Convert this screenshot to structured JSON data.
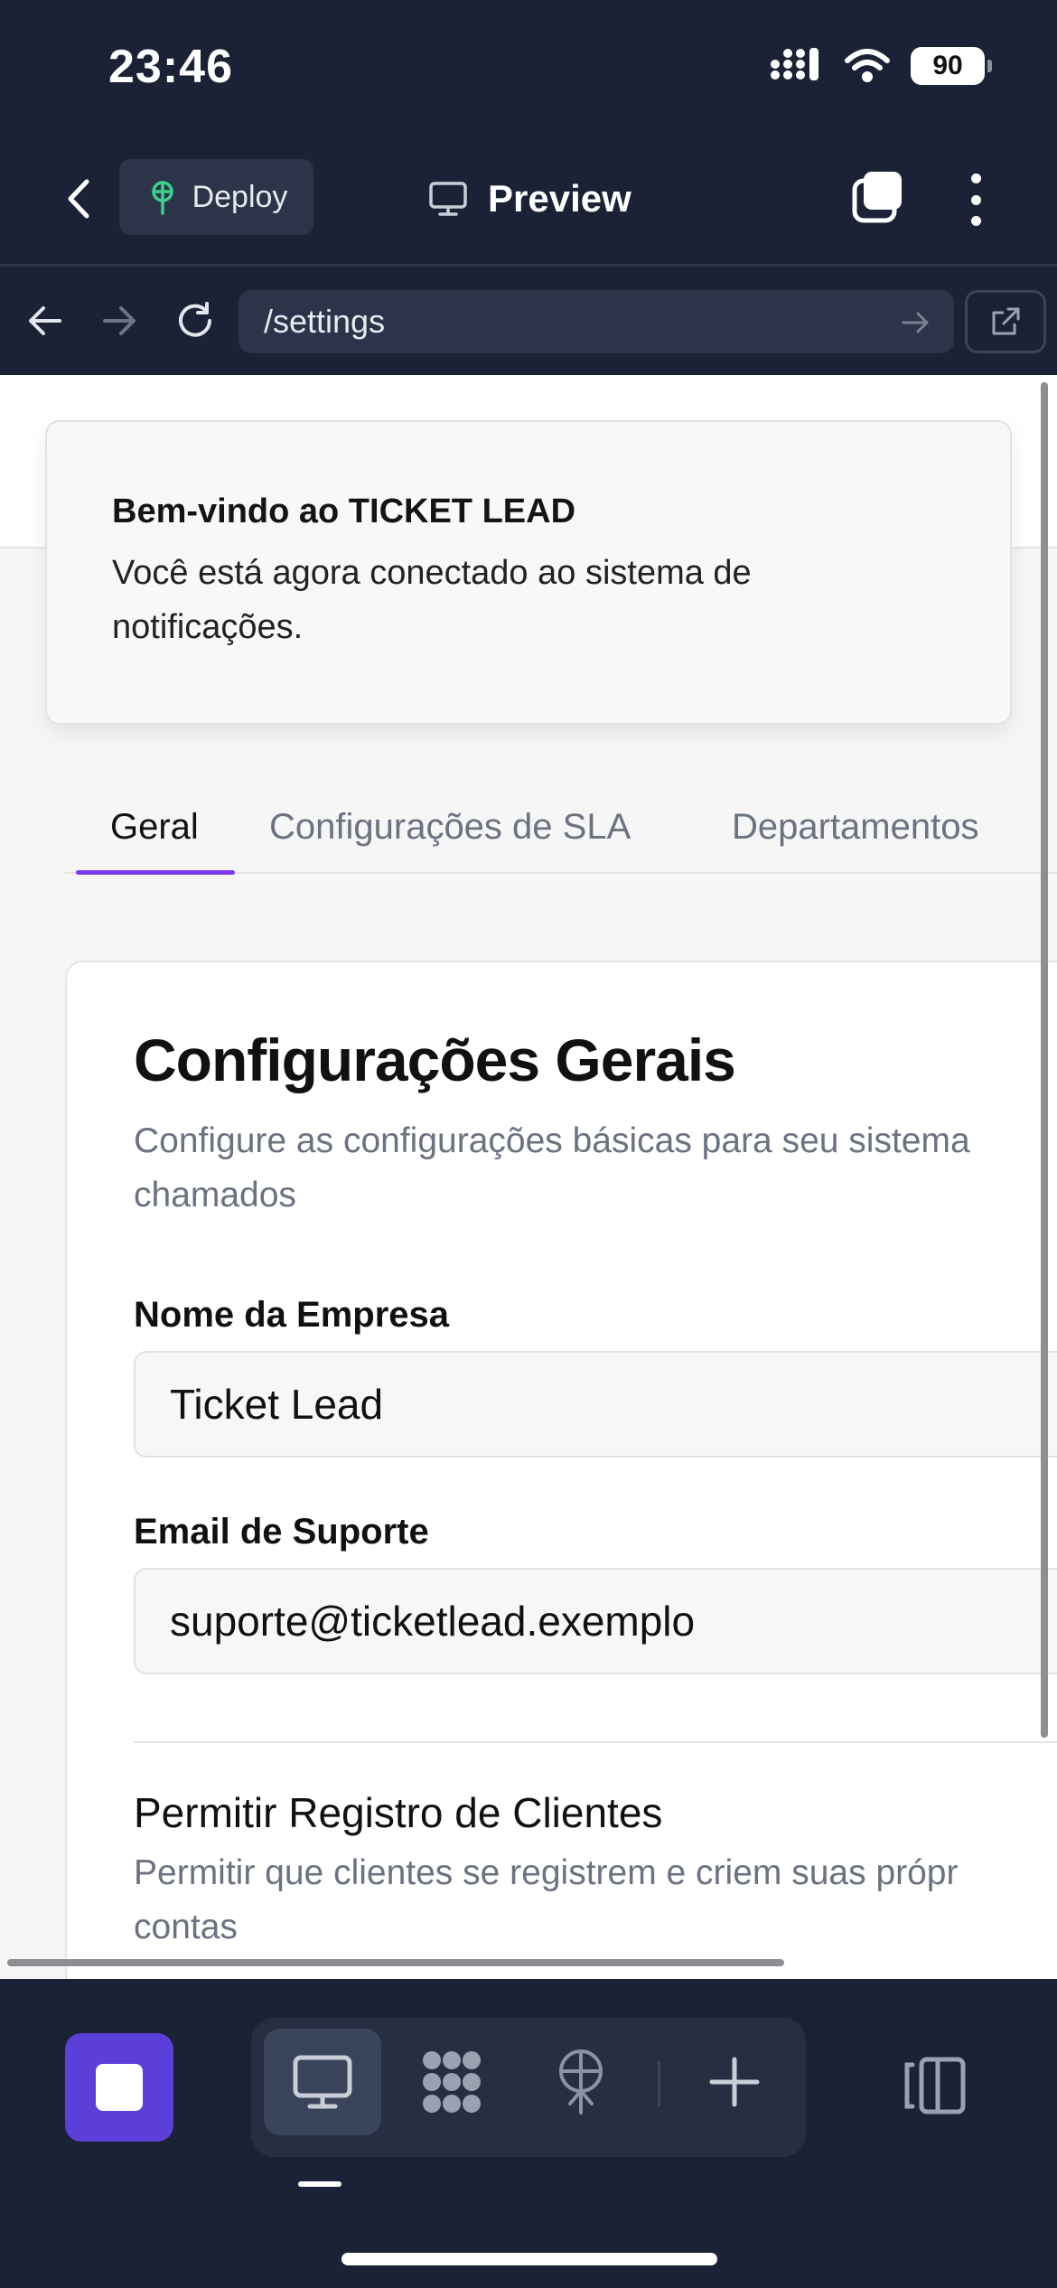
{
  "status_bar": {
    "time": "23:46",
    "battery": "90"
  },
  "top_bar": {
    "deploy_label": "Deploy",
    "preview_label": "Preview"
  },
  "address_bar": {
    "url": "/settings"
  },
  "toast": {
    "title": "Bem-vindo ao TICKET LEAD",
    "message": "Você está agora conectado ao sistema de notificações."
  },
  "tabs": [
    {
      "label": "Geral",
      "active": true
    },
    {
      "label": "Configurações de SLA",
      "active": false
    },
    {
      "label": "Departamentos",
      "active": false
    }
  ],
  "general_settings": {
    "title": "Configurações Gerais",
    "description_line1": "Configure as configurações básicas para seu sistema",
    "description_line2": "chamados",
    "company_name_label": "Nome da Empresa",
    "company_name_value": "Ticket Lead",
    "support_email_label": "Email de Suporte",
    "support_email_value": "suporte@ticketlead.exemplo",
    "allow_registration_title": "Permitir Registro de Clientes",
    "allow_registration_desc_line1": "Permitir que clientes se registrem e criem suas própr",
    "allow_registration_desc_line2": "contas"
  },
  "colors": {
    "accent": "#7c3aed",
    "stop_button": "#5b3fd8",
    "chrome_bg": "#1b2235"
  },
  "icons": [
    "back-chevron-icon",
    "deploy-icon",
    "monitor-icon",
    "tabs-icon",
    "more-vertical-icon",
    "arrow-left-icon",
    "arrow-right-icon",
    "reload-icon",
    "external-link-icon",
    "stop-icon",
    "grid-icon",
    "antenna-icon",
    "plus-icon",
    "sidebar-panel-icon"
  ]
}
